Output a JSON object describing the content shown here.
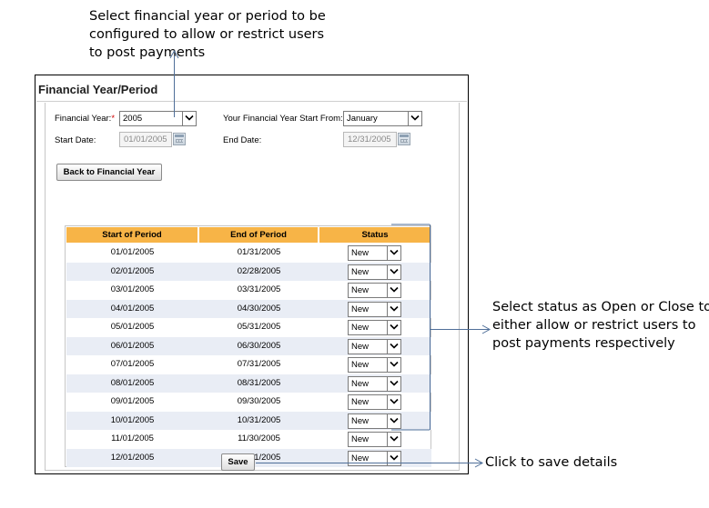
{
  "callouts": {
    "top": [
      "Select financial year or period to be",
      "configured to allow or restrict users",
      "to post payments"
    ],
    "status": [
      "Select status as Open or Close to",
      "either allow or restrict users to",
      "post payments respectively"
    ],
    "save": "Click to save details"
  },
  "panel": {
    "title": "Financial Year/Period",
    "financial_year": {
      "label": "Financial Year:",
      "required_mark": "*",
      "value": "2005"
    },
    "start_from": {
      "label": "Your Financial Year Start From:",
      "value": "January"
    },
    "start_date": {
      "label": "Start Date:",
      "value": "01/01/2005"
    },
    "end_date": {
      "label": "End Date:",
      "value": "12/31/2005"
    },
    "back_button": "Back to Financial Year",
    "save_button": "Save"
  },
  "table": {
    "headers": [
      "Start of Period",
      "End of Period",
      "Status"
    ],
    "rows": [
      {
        "start": "01/01/2005",
        "end": "01/31/2005",
        "status": "New"
      },
      {
        "start": "02/01/2005",
        "end": "02/28/2005",
        "status": "New"
      },
      {
        "start": "03/01/2005",
        "end": "03/31/2005",
        "status": "New"
      },
      {
        "start": "04/01/2005",
        "end": "04/30/2005",
        "status": "New"
      },
      {
        "start": "05/01/2005",
        "end": "05/31/2005",
        "status": "New"
      },
      {
        "start": "06/01/2005",
        "end": "06/30/2005",
        "status": "New"
      },
      {
        "start": "07/01/2005",
        "end": "07/31/2005",
        "status": "New"
      },
      {
        "start": "08/01/2005",
        "end": "08/31/2005",
        "status": "New"
      },
      {
        "start": "09/01/2005",
        "end": "09/30/2005",
        "status": "New"
      },
      {
        "start": "10/01/2005",
        "end": "10/31/2005",
        "status": "New"
      },
      {
        "start": "11/01/2005",
        "end": "11/30/2005",
        "status": "New"
      },
      {
        "start": "12/01/2005",
        "end": "12/31/2005",
        "status": "New"
      }
    ]
  },
  "icons": {
    "dropdown": "chevron-down-icon",
    "calendar": "calendar-icon",
    "callout_arrow": "arrow-icon"
  },
  "colors": {
    "header_bg": "#f7b447",
    "alt_row_bg": "#e9edf5",
    "connector": "#4f6f99",
    "required": "#d00000"
  }
}
